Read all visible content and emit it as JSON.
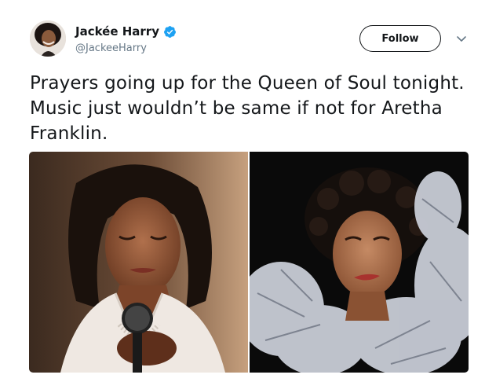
{
  "author": {
    "display_name": "Jackée Harry",
    "handle": "@JackeeHarry",
    "verified": true,
    "avatar_icon": "profile-photo"
  },
  "actions": {
    "follow_label": "Follow",
    "menu_icon": "chevron-down-icon"
  },
  "tweet": {
    "text": "Prayers going up for the Queen of Soul tonight. Music just wouldn’t be same if not for Aretha Franklin."
  },
  "media": {
    "photos": [
      {
        "subject": "wax-figure-with-microphone"
      },
      {
        "subject": "woman-in-feather-boa"
      }
    ]
  },
  "colors": {
    "text": "#14171a",
    "secondary_text": "#657786",
    "verified_blue": "#1da1f2",
    "follow_border": "#14171a"
  }
}
